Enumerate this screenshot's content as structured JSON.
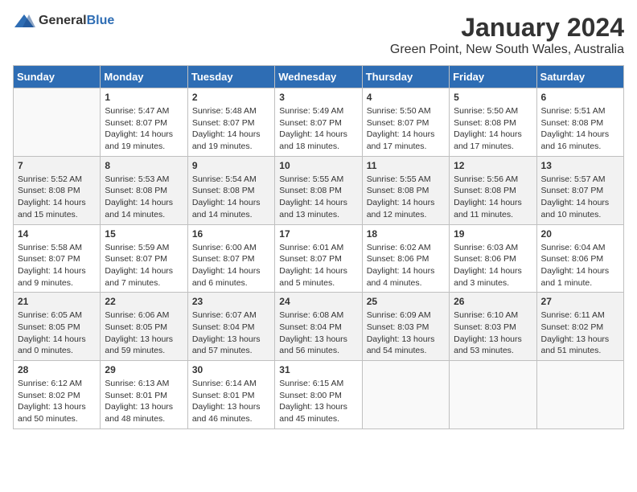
{
  "header": {
    "logo_general": "General",
    "logo_blue": "Blue",
    "title": "January 2024",
    "subtitle": "Green Point, New South Wales, Australia"
  },
  "days_of_week": [
    "Sunday",
    "Monday",
    "Tuesday",
    "Wednesday",
    "Thursday",
    "Friday",
    "Saturday"
  ],
  "weeks": [
    [
      {
        "day": "",
        "info": ""
      },
      {
        "day": "1",
        "info": "Sunrise: 5:47 AM\nSunset: 8:07 PM\nDaylight: 14 hours\nand 19 minutes."
      },
      {
        "day": "2",
        "info": "Sunrise: 5:48 AM\nSunset: 8:07 PM\nDaylight: 14 hours\nand 19 minutes."
      },
      {
        "day": "3",
        "info": "Sunrise: 5:49 AM\nSunset: 8:07 PM\nDaylight: 14 hours\nand 18 minutes."
      },
      {
        "day": "4",
        "info": "Sunrise: 5:50 AM\nSunset: 8:07 PM\nDaylight: 14 hours\nand 17 minutes."
      },
      {
        "day": "5",
        "info": "Sunrise: 5:50 AM\nSunset: 8:08 PM\nDaylight: 14 hours\nand 17 minutes."
      },
      {
        "day": "6",
        "info": "Sunrise: 5:51 AM\nSunset: 8:08 PM\nDaylight: 14 hours\nand 16 minutes."
      }
    ],
    [
      {
        "day": "7",
        "info": "Sunrise: 5:52 AM\nSunset: 8:08 PM\nDaylight: 14 hours\nand 15 minutes."
      },
      {
        "day": "8",
        "info": "Sunrise: 5:53 AM\nSunset: 8:08 PM\nDaylight: 14 hours\nand 14 minutes."
      },
      {
        "day": "9",
        "info": "Sunrise: 5:54 AM\nSunset: 8:08 PM\nDaylight: 14 hours\nand 14 minutes."
      },
      {
        "day": "10",
        "info": "Sunrise: 5:55 AM\nSunset: 8:08 PM\nDaylight: 14 hours\nand 13 minutes."
      },
      {
        "day": "11",
        "info": "Sunrise: 5:55 AM\nSunset: 8:08 PM\nDaylight: 14 hours\nand 12 minutes."
      },
      {
        "day": "12",
        "info": "Sunrise: 5:56 AM\nSunset: 8:08 PM\nDaylight: 14 hours\nand 11 minutes."
      },
      {
        "day": "13",
        "info": "Sunrise: 5:57 AM\nSunset: 8:07 PM\nDaylight: 14 hours\nand 10 minutes."
      }
    ],
    [
      {
        "day": "14",
        "info": "Sunrise: 5:58 AM\nSunset: 8:07 PM\nDaylight: 14 hours\nand 9 minutes."
      },
      {
        "day": "15",
        "info": "Sunrise: 5:59 AM\nSunset: 8:07 PM\nDaylight: 14 hours\nand 7 minutes."
      },
      {
        "day": "16",
        "info": "Sunrise: 6:00 AM\nSunset: 8:07 PM\nDaylight: 14 hours\nand 6 minutes."
      },
      {
        "day": "17",
        "info": "Sunrise: 6:01 AM\nSunset: 8:07 PM\nDaylight: 14 hours\nand 5 minutes."
      },
      {
        "day": "18",
        "info": "Sunrise: 6:02 AM\nSunset: 8:06 PM\nDaylight: 14 hours\nand 4 minutes."
      },
      {
        "day": "19",
        "info": "Sunrise: 6:03 AM\nSunset: 8:06 PM\nDaylight: 14 hours\nand 3 minutes."
      },
      {
        "day": "20",
        "info": "Sunrise: 6:04 AM\nSunset: 8:06 PM\nDaylight: 14 hours\nand 1 minute."
      }
    ],
    [
      {
        "day": "21",
        "info": "Sunrise: 6:05 AM\nSunset: 8:05 PM\nDaylight: 14 hours\nand 0 minutes."
      },
      {
        "day": "22",
        "info": "Sunrise: 6:06 AM\nSunset: 8:05 PM\nDaylight: 13 hours\nand 59 minutes."
      },
      {
        "day": "23",
        "info": "Sunrise: 6:07 AM\nSunset: 8:04 PM\nDaylight: 13 hours\nand 57 minutes."
      },
      {
        "day": "24",
        "info": "Sunrise: 6:08 AM\nSunset: 8:04 PM\nDaylight: 13 hours\nand 56 minutes."
      },
      {
        "day": "25",
        "info": "Sunrise: 6:09 AM\nSunset: 8:03 PM\nDaylight: 13 hours\nand 54 minutes."
      },
      {
        "day": "26",
        "info": "Sunrise: 6:10 AM\nSunset: 8:03 PM\nDaylight: 13 hours\nand 53 minutes."
      },
      {
        "day": "27",
        "info": "Sunrise: 6:11 AM\nSunset: 8:02 PM\nDaylight: 13 hours\nand 51 minutes."
      }
    ],
    [
      {
        "day": "28",
        "info": "Sunrise: 6:12 AM\nSunset: 8:02 PM\nDaylight: 13 hours\nand 50 minutes."
      },
      {
        "day": "29",
        "info": "Sunrise: 6:13 AM\nSunset: 8:01 PM\nDaylight: 13 hours\nand 48 minutes."
      },
      {
        "day": "30",
        "info": "Sunrise: 6:14 AM\nSunset: 8:01 PM\nDaylight: 13 hours\nand 46 minutes."
      },
      {
        "day": "31",
        "info": "Sunrise: 6:15 AM\nSunset: 8:00 PM\nDaylight: 13 hours\nand 45 minutes."
      },
      {
        "day": "",
        "info": ""
      },
      {
        "day": "",
        "info": ""
      },
      {
        "day": "",
        "info": ""
      }
    ]
  ]
}
